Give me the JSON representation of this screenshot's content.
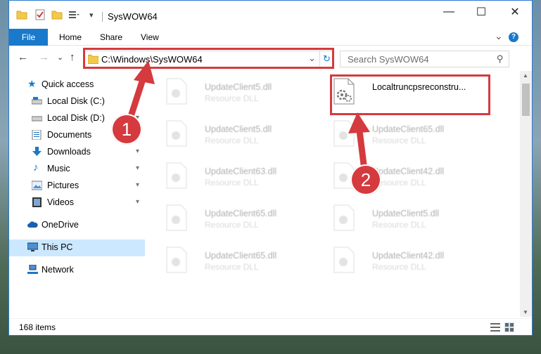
{
  "window": {
    "title": "SysWOW64",
    "controls": {
      "minimize": "—",
      "maximize": "☐",
      "close": "✕"
    }
  },
  "ribbon": {
    "tabs": [
      "File",
      "Home",
      "Share",
      "View"
    ],
    "expand_glyph": "⌄",
    "help_glyph": "?"
  },
  "navigation": {
    "back_glyph": "←",
    "forward_glyph": "→",
    "recent_glyph": "⌄",
    "up_glyph": "↑",
    "address": "C:\\Windows\\SysWOW64",
    "address_dropdown": "⌄",
    "refresh_glyph": "↻",
    "search_placeholder": "Search SysWOW64",
    "search_glyph": "⚲"
  },
  "sidebar": {
    "items": [
      {
        "label": "Quick access",
        "icon": "star-icon",
        "pinned": false
      },
      {
        "label": "Local Disk (C:)",
        "icon": "drive-icon",
        "pinned": true
      },
      {
        "label": "Local Disk (D:)",
        "icon": "drive-icon",
        "pinned": true
      },
      {
        "label": "Documents",
        "icon": "documents-icon",
        "pinned": true
      },
      {
        "label": "Downloads",
        "icon": "downloads-icon",
        "pinned": true
      },
      {
        "label": "Music",
        "icon": "music-icon",
        "pinned": true
      },
      {
        "label": "Pictures",
        "icon": "pictures-icon",
        "pinned": true
      },
      {
        "label": "Videos",
        "icon": "videos-icon",
        "pinned": true
      },
      {
        "label": "OneDrive",
        "icon": "onedrive-icon",
        "pinned": false
      },
      {
        "label": "This PC",
        "icon": "pc-icon",
        "pinned": false,
        "selected": true
      },
      {
        "label": "Network",
        "icon": "network-icon",
        "pinned": false
      }
    ],
    "pin_glyph": "📌"
  },
  "files": [
    {
      "name": "UpdateClient5.dll",
      "type": "Resource DLL"
    },
    {
      "name": "Localtruncpsreconstru...",
      "type": ""
    },
    {
      "name": "UpdateClient5.dll",
      "type": "Resource DLL"
    },
    {
      "name": "UpdateClient65.dll",
      "type": "Resource DLL"
    },
    {
      "name": "UpdateClient63.dll",
      "type": "Resource DLL"
    },
    {
      "name": "UpdateClient42.dll",
      "type": "Resource DLL"
    },
    {
      "name": "UpdateClient65.dll",
      "type": "Resource DLL"
    },
    {
      "name": "UpdateClient5.dll",
      "type": "Resource DLL"
    },
    {
      "name": "UpdateClient65.dll",
      "type": "Resource DLL"
    },
    {
      "name": "UpdateClient42.dll",
      "type": "Resource DLL"
    }
  ],
  "status": {
    "item_count": "168 items"
  },
  "annotations": {
    "step1": "1",
    "step2": "2",
    "color": "#d53a3e"
  }
}
